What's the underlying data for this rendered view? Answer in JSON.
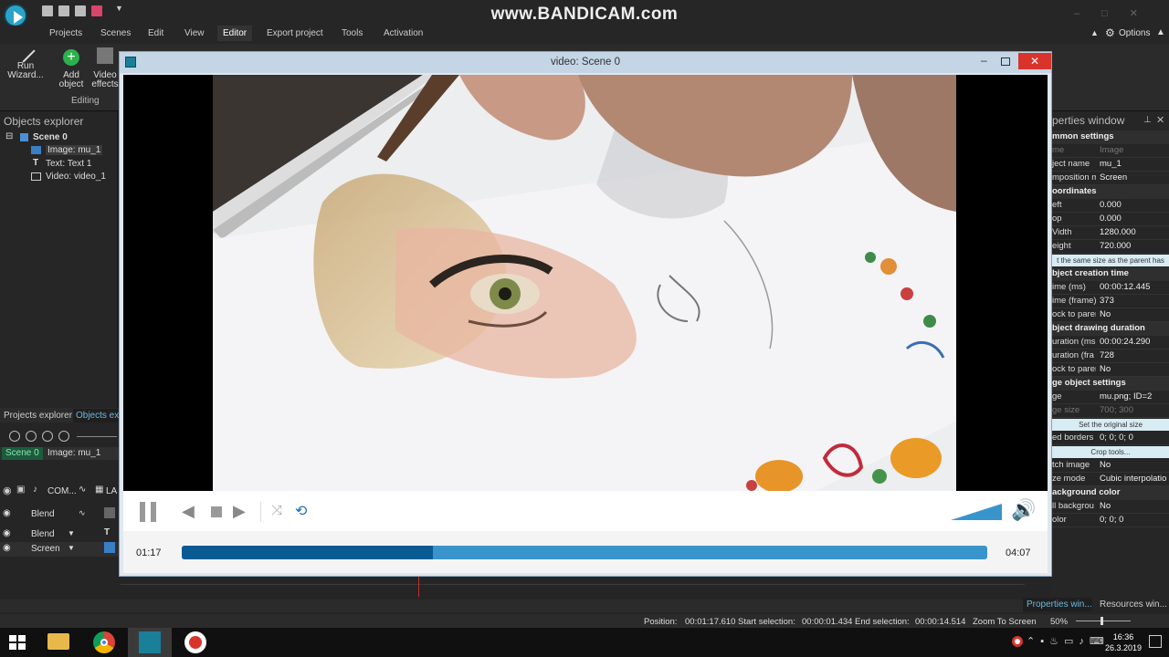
{
  "watermark": "www.BANDICAM.com",
  "menu": [
    "Projects",
    "Scenes",
    "Edit",
    "View",
    "Editor",
    "Export project",
    "Tools",
    "Activation"
  ],
  "menu_active": "Editor",
  "options_label": "Options",
  "ribbon": {
    "run_wizard": "Run",
    "run_wizard2": "Wizard...",
    "add_object": "Add",
    "add_object2": "object",
    "video_effects": "Video",
    "video_effects2": "effects",
    "group_label": "Editing"
  },
  "objects_explorer": {
    "title": "Objects explorer",
    "items": [
      "Scene 0",
      "Image: mu_1",
      "Text: Text 1",
      "Video: video_1"
    ]
  },
  "lower_tabs": [
    "Projects explorer",
    "Objects ex"
  ],
  "timeline": {
    "breadcrumb": [
      "Scene 0",
      "Image: mu_1"
    ],
    "header_com": "COM...",
    "header_la": "LA",
    "rows": [
      "Blend",
      "Blend",
      "Screen"
    ]
  },
  "player": {
    "title": "video: Scene 0",
    "current_time": "01:17",
    "total_time": "04:07",
    "progress": 0.312
  },
  "properties": {
    "title": "perties window",
    "rows": [
      {
        "type": "group",
        "label": "mmon settings"
      },
      {
        "type": "row",
        "k": "me",
        "v": "Image"
      },
      {
        "type": "row",
        "k": "ject name",
        "v": "mu_1"
      },
      {
        "type": "row",
        "k": "mposition m",
        "v": "Screen"
      },
      {
        "type": "group",
        "label": "oordinates"
      },
      {
        "type": "row",
        "k": "eft",
        "v": "0.000"
      },
      {
        "type": "row",
        "k": "op",
        "v": "0.000"
      },
      {
        "type": "row",
        "k": "Vidth",
        "v": "1280.000"
      },
      {
        "type": "row",
        "k": "eight",
        "v": "720.000"
      },
      {
        "type": "btn",
        "label": "t the same size as the parent has"
      },
      {
        "type": "group",
        "label": "bject creation time"
      },
      {
        "type": "row",
        "k": "ime (ms)",
        "v": "00:00:12.445"
      },
      {
        "type": "row",
        "k": "ime (frame)",
        "v": "373"
      },
      {
        "type": "row",
        "k": "ock to parer",
        "v": "No"
      },
      {
        "type": "group",
        "label": "bject drawing duration"
      },
      {
        "type": "row",
        "k": "uration (ms",
        "v": "00:00:24.290"
      },
      {
        "type": "row",
        "k": "uration (fra",
        "v": "728"
      },
      {
        "type": "row",
        "k": "ock to parer",
        "v": "No"
      },
      {
        "type": "group",
        "label": "ge object settings"
      },
      {
        "type": "row",
        "k": "ge",
        "v": "mu.png; ID=2"
      },
      {
        "type": "row",
        "k": "ge size",
        "v": "700; 300"
      },
      {
        "type": "btn",
        "label": "Set the original size"
      },
      {
        "type": "row",
        "k": "ed borders",
        "v": "0; 0; 0; 0"
      },
      {
        "type": "btn",
        "label": "Crop tools..."
      },
      {
        "type": "row",
        "k": "tch image",
        "v": "No"
      },
      {
        "type": "row",
        "k": "ze mode",
        "v": "Cubic interpolatio"
      },
      {
        "type": "group",
        "label": "ackground color"
      },
      {
        "type": "row",
        "k": "ll backgrou",
        "v": "No"
      },
      {
        "type": "row",
        "k": "olor",
        "v": "0; 0; 0"
      }
    ]
  },
  "bottom_tabs": [
    "Properties win...",
    "Resources win..."
  ],
  "status": {
    "position_label": "Position:",
    "position": "00:01:17.610",
    "start_label": "Start selection:",
    "start": "00:00:01.434",
    "end_label": "End selection:",
    "end": "00:00:14.514",
    "zoom_label": "Zoom To Screen",
    "zoom": "50%"
  },
  "clock": {
    "time": "16:36",
    "date": "26.3.2019"
  },
  "colors": {
    "accent": "#0a5b94",
    "seek": "#3a94cc",
    "close": "#d9342b"
  }
}
